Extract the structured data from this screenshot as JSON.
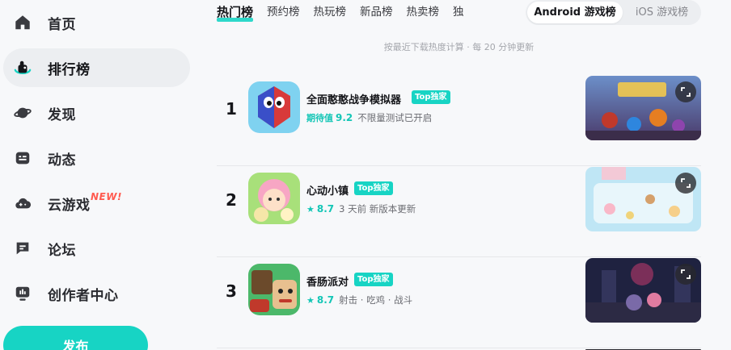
{
  "sidebar": {
    "items": [
      {
        "label": "首页",
        "icon": "home-icon"
      },
      {
        "label": "排行榜",
        "icon": "ranking-icon"
      },
      {
        "label": "发现",
        "icon": "planet-icon"
      },
      {
        "label": "动态",
        "icon": "feed-icon"
      },
      {
        "label": "云游戏",
        "icon": "cloud-game-icon",
        "badge": "NEW!"
      },
      {
        "label": "论坛",
        "icon": "forum-icon"
      },
      {
        "label": "创作者中心",
        "icon": "creator-icon"
      }
    ],
    "active_index": 1,
    "publish_label": "发布"
  },
  "tabs": [
    "热门榜",
    "预约榜",
    "热玩榜",
    "新品榜",
    "热卖榜",
    "独"
  ],
  "active_tab": 0,
  "platform": {
    "active": "Android 游戏榜",
    "inactive": "iOS 游戏榜"
  },
  "hint": "按最近下载热度计算 · 每 20 分钟更新",
  "games": [
    {
      "rank": "1",
      "name": "全面憨憨战争模拟器",
      "badge": "Top独家",
      "score_label": "期待值",
      "score": "9.2",
      "meta": "不限量测试已开启"
    },
    {
      "rank": "2",
      "name": "心动小镇",
      "badge": "Top独家",
      "score_label": "★",
      "score": "8.7",
      "meta": "3 天前 新版本更新"
    },
    {
      "rank": "3",
      "name": "香肠派对",
      "badge": "Top独家",
      "score_label": "★",
      "score": "8.7",
      "meta": "射击 · 吃鸡 · 战斗"
    }
  ],
  "colors": {
    "accent": "#17d4c4",
    "new_badge": "#ff5a4f",
    "background": "#f7f8fa"
  }
}
